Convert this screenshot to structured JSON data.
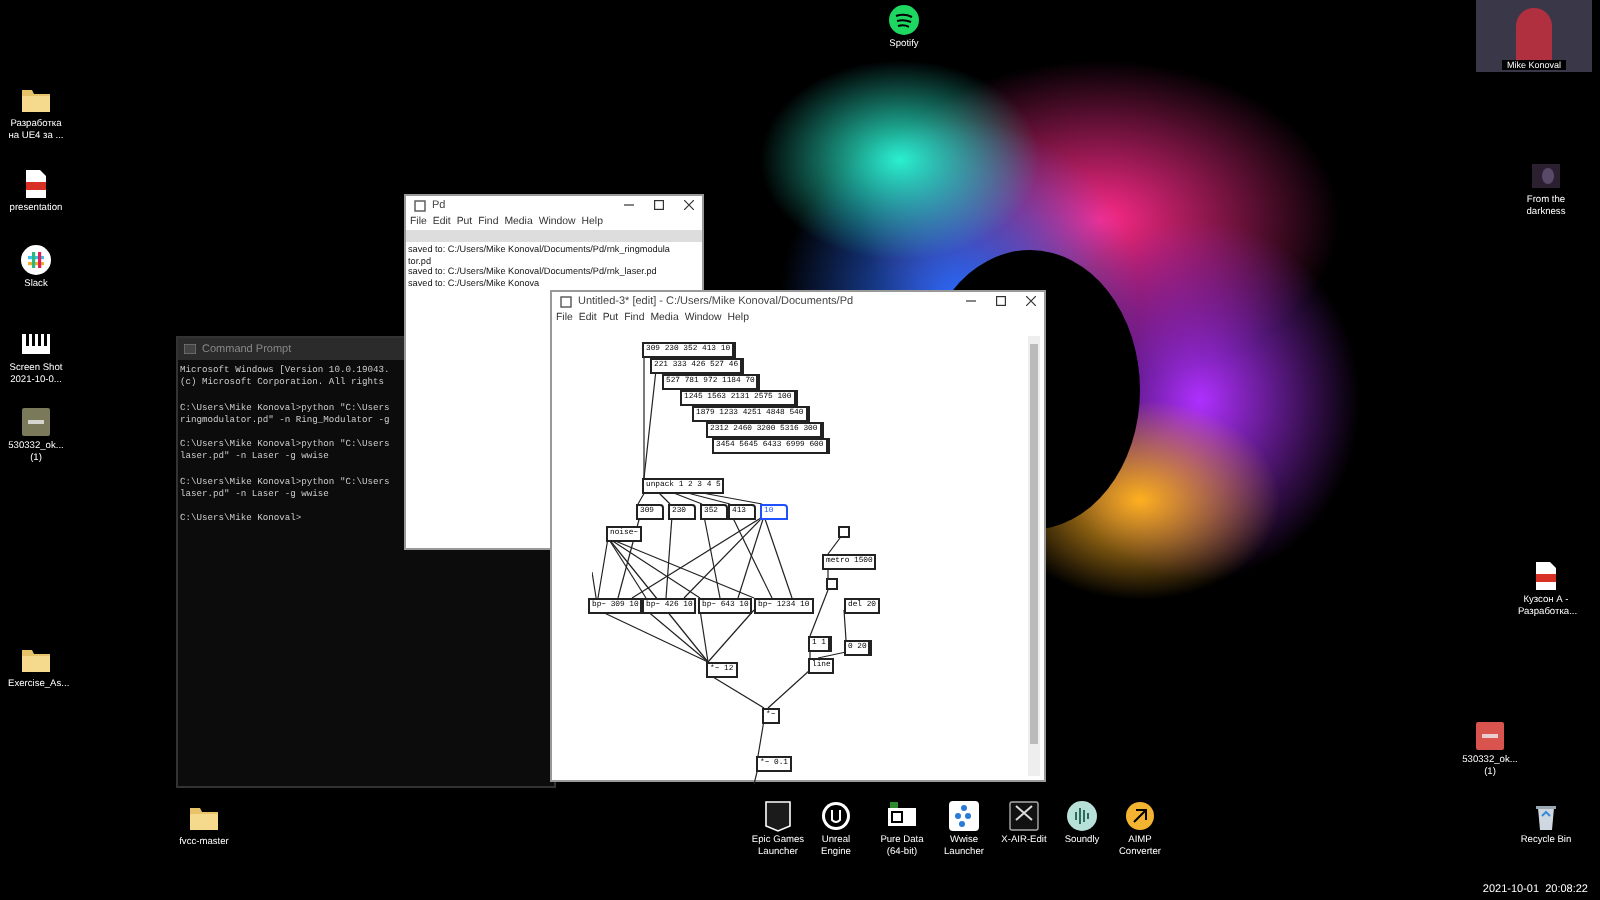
{
  "desktop": {
    "left_icons": [
      {
        "label": "Разработка на UE4 за ...",
        "kind": "folder"
      },
      {
        "label": "presentation",
        "kind": "pdf"
      },
      {
        "label": "Slack",
        "kind": "slack"
      },
      {
        "label": "Screen Shot 2021-10-0...",
        "kind": "piano"
      },
      {
        "label": "530332_ok... (1)",
        "kind": "wav"
      },
      {
        "label": "Exercise_As...",
        "kind": "folder"
      },
      {
        "label": "fvcc-master",
        "kind": "folder"
      }
    ],
    "top_icons": [
      {
        "label": "Spotify",
        "kind": "spotify"
      }
    ],
    "dock_icons": [
      {
        "label": "Epic Games Launcher",
        "kind": "epic"
      },
      {
        "label": "Unreal Engine",
        "kind": "unreal"
      },
      {
        "label": "Pure Data (64-bit)",
        "kind": "puredata"
      },
      {
        "label": "Wwise Launcher",
        "kind": "wwise"
      },
      {
        "label": "X-AIR-Edit",
        "kind": "xair"
      },
      {
        "label": "Soundly",
        "kind": "soundly"
      },
      {
        "label": "AIMP Converter",
        "kind": "aimp"
      }
    ],
    "right_icons": [
      {
        "label": "From the darkness",
        "kind": "video"
      },
      {
        "label": "Кузсон А - Разработка...",
        "kind": "pdf"
      },
      {
        "label": "530332_ok... (1)",
        "kind": "mp3"
      },
      {
        "label": "Recycle Bin",
        "kind": "recycle"
      }
    ],
    "timestamp": "2021-10-01  20:08:22"
  },
  "webcam": {
    "name": "Mike Konoval"
  },
  "command_prompt": {
    "title": "Command Prompt",
    "paragraphs": [
      [
        "Microsoft Windows [Version 10.0.19043.",
        "(c) Microsoft Corporation. All rights"
      ],
      [
        "C:\\Users\\Mike Konoval>python \"C:\\Users",
        "ringmodulator.pd\" -n Ring_Modulator -g"
      ],
      [
        "C:\\Users\\Mike Konoval>python \"C:\\Users",
        "laser.pd\" -n Laser -g wwise"
      ],
      [
        "C:\\Users\\Mike Konoval>python \"C:\\Users",
        "laser.pd\" -n Laser -g wwise"
      ],
      [
        "C:\\Users\\Mike Konoval>"
      ]
    ]
  },
  "pd_main": {
    "title": "Pd",
    "menu": [
      "File",
      "Edit",
      "Put",
      "Find",
      "Media",
      "Window",
      "Help"
    ],
    "log": [
      "saved to: C:/Users/Mike Konoval/Documents/Pd/rnk_ringmodula",
      "tor.pd",
      "saved to: C:/Users/Mike Konoval/Documents/Pd/rnk_laser.pd",
      "saved to: C:/Users/Mike Konova"
    ]
  },
  "patch_window": {
    "title": "Untitled-3* [edit] - C:/Users/Mike Konoval/Documents/Pd",
    "menu": [
      "File",
      "Edit",
      "Put",
      "Find",
      "Media",
      "Window",
      "Help"
    ],
    "objects": [
      {
        "kind": "msg",
        "text": "309 230 352 413 10",
        "selected": false
      },
      {
        "kind": "msg",
        "text": "221 333 426 527 46",
        "selected": false
      },
      {
        "kind": "msg",
        "text": "527 781 972 1184 70",
        "selected": false
      },
      {
        "kind": "msg",
        "text": "1245 1563 2131 2575 100",
        "selected": false
      },
      {
        "kind": "msg",
        "text": "1879 1233 4251 4848 540",
        "selected": false
      },
      {
        "kind": "msg",
        "text": "2312 2460 3200 5316 300",
        "selected": false
      },
      {
        "kind": "msg",
        "text": "3454 5645 6433 6999 600",
        "selected": false
      },
      {
        "kind": "obj",
        "text": "unpack 1 2 3 4 5",
        "selected": false
      },
      {
        "kind": "number",
        "text": "309",
        "selected": false
      },
      {
        "kind": "number",
        "text": "230",
        "selected": false
      },
      {
        "kind": "number",
        "text": "352",
        "selected": false
      },
      {
        "kind": "number",
        "text": "413",
        "selected": false
      },
      {
        "kind": "number",
        "text": "10",
        "selected": true
      },
      {
        "kind": "obj",
        "text": "noise~",
        "selected": false
      },
      {
        "kind": "obj",
        "text": "bp~ 309 10",
        "selected": false
      },
      {
        "kind": "obj",
        "text": "bp~ 426 10",
        "selected": false
      },
      {
        "kind": "obj",
        "text": "bp~ 643 10",
        "selected": false
      },
      {
        "kind": "obj",
        "text": "bp~ 1234 10",
        "selected": false
      },
      {
        "kind": "obj",
        "text": "*~ 12",
        "selected": false
      },
      {
        "kind": "bang",
        "selected": false
      },
      {
        "kind": "obj",
        "text": "metro 1500",
        "selected": false
      },
      {
        "kind": "bang",
        "selected": false
      },
      {
        "kind": "obj",
        "text": "del 20",
        "selected": false
      },
      {
        "kind": "msg",
        "text": "1 1",
        "selected": false
      },
      {
        "kind": "msg",
        "text": "0 20",
        "selected": false
      },
      {
        "kind": "obj",
        "text": "line",
        "selected": false
      },
      {
        "kind": "obj",
        "text": "*~",
        "selected": false
      },
      {
        "kind": "obj",
        "text": "*~ 0.1",
        "selected": false
      }
    ]
  }
}
